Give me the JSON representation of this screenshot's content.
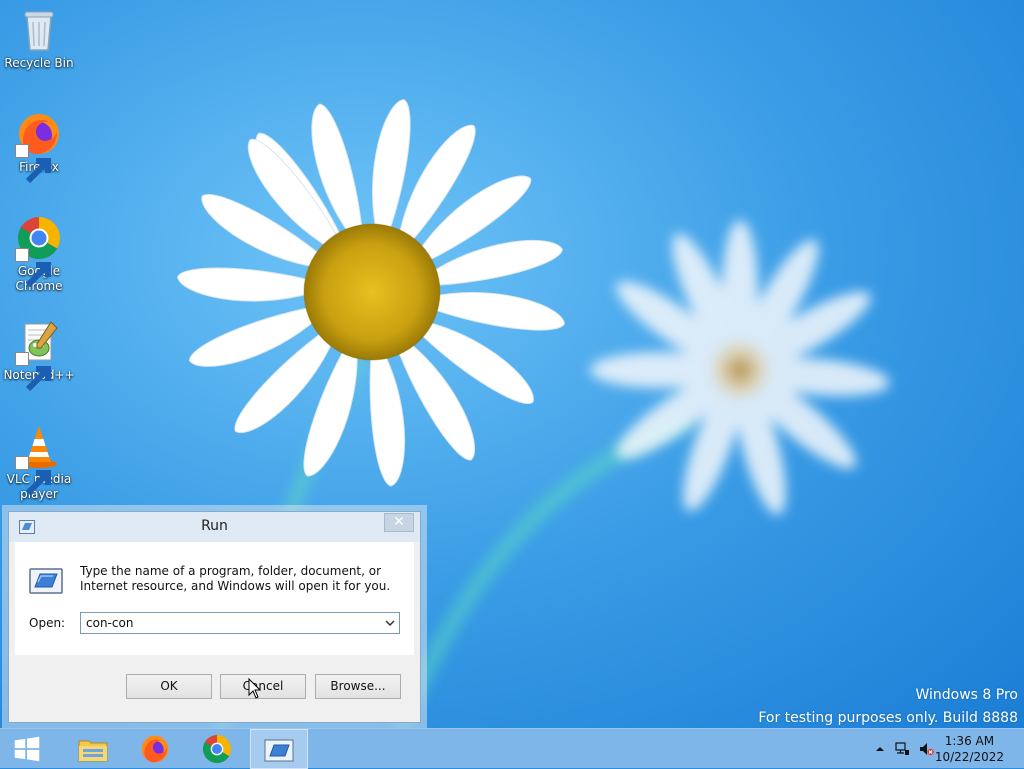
{
  "desktop": {
    "icons": [
      {
        "label": "Recycle Bin",
        "icon": "recycle-bin-icon"
      },
      {
        "label": "Firefox",
        "icon": "firefox-icon"
      },
      {
        "label": "Google\nChrome",
        "icon": "chrome-icon"
      },
      {
        "label": "Notepad++",
        "icon": "notepadpp-icon"
      },
      {
        "label": "VLC media\nplayer",
        "icon": "vlc-icon"
      }
    ]
  },
  "run_dialog": {
    "title": "Run",
    "close_glyph": "✕",
    "description": "Type the name of a program, folder, document, or Internet resource, and Windows will open it for you.",
    "open_label": "Open:",
    "open_value": "con-con",
    "buttons": {
      "ok": "OK",
      "cancel": "Cancel",
      "browse": "Browse..."
    }
  },
  "watermark": {
    "line1": "Windows 8 Pro",
    "line2": "For testing purposes only. Build 8888"
  },
  "taskbar": {
    "items": [
      "start-icon",
      "file-explorer-icon",
      "firefox-icon",
      "chrome-icon",
      "run-icon"
    ],
    "clock": {
      "time": "1:36 AM",
      "date": "10/22/2022"
    }
  },
  "colors": {
    "taskbar": "#7fb6ea",
    "wallpaper": "#2a8fe0",
    "dialog_bg": "#f0f0f0"
  }
}
